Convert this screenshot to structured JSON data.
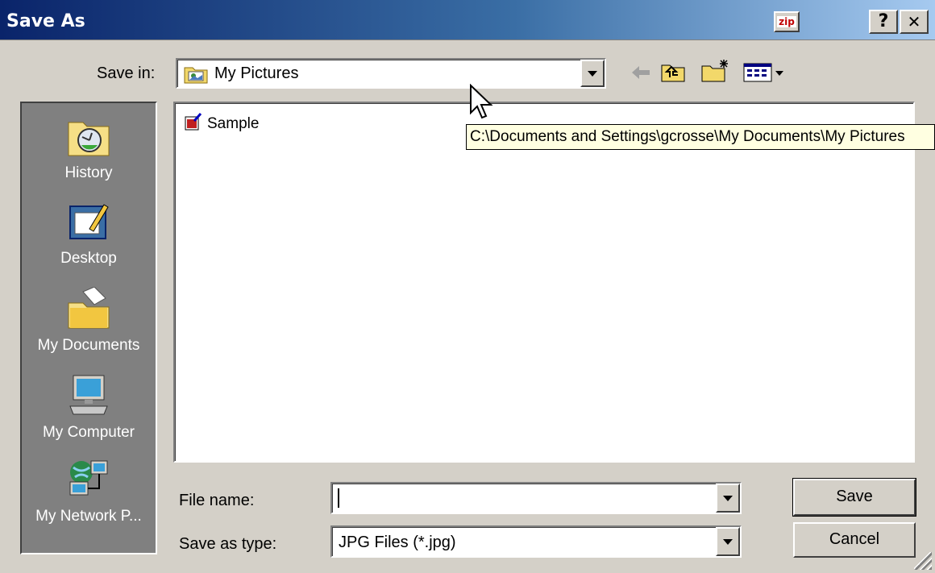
{
  "window": {
    "title": "Save As",
    "zip_label": "zip",
    "help_label": "?",
    "close_label": "✕"
  },
  "save_in": {
    "label": "Save in:",
    "value": "My Pictures",
    "icon": "picture-folder-icon"
  },
  "toolbar": {
    "back_icon": "back-arrow-icon",
    "up_icon": "up-one-level-icon",
    "new_folder_icon": "new-folder-icon",
    "view_menu_icon": "view-menu-icon"
  },
  "places": [
    {
      "label": "History",
      "icon": "history-icon"
    },
    {
      "label": "Desktop",
      "icon": "desktop-icon"
    },
    {
      "label": "My Documents",
      "icon": "my-documents-icon"
    },
    {
      "label": "My Computer",
      "icon": "my-computer-icon"
    },
    {
      "label": "My Network P...",
      "icon": "my-network-places-icon"
    }
  ],
  "files": [
    {
      "name": "Sample",
      "icon": "image-file-icon"
    }
  ],
  "tooltip": "C:\\Documents and Settings\\gcrosse\\My Documents\\My Pictures",
  "file_name": {
    "label": "File name:",
    "value": ""
  },
  "save_as_type": {
    "label": "Save as type:",
    "value": "JPG Files (*.jpg)"
  },
  "buttons": {
    "save": "Save",
    "cancel": "Cancel"
  }
}
